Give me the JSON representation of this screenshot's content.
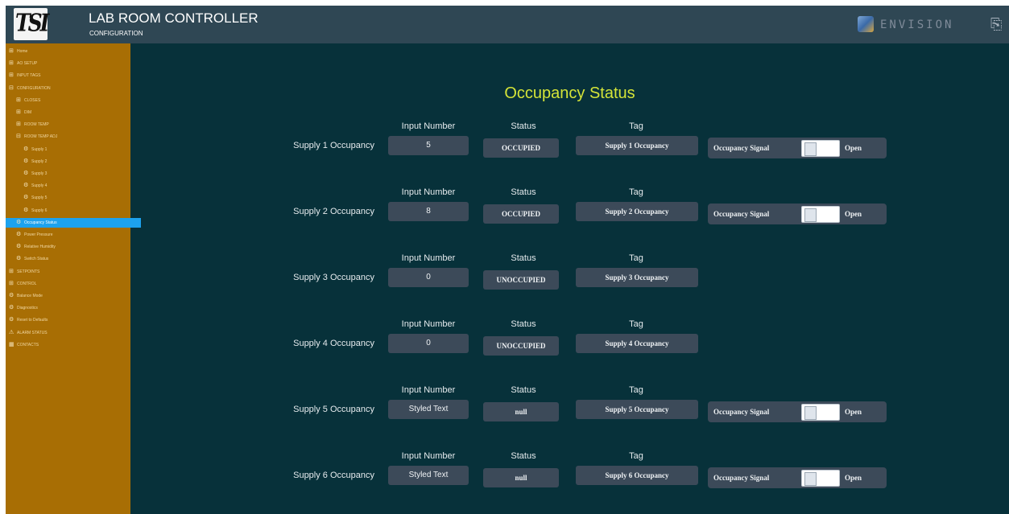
{
  "header": {
    "logo_text": "TSI",
    "title": "LAB ROOM CONTROLLER",
    "subtitle": "CONFIGURATION",
    "brand": "ENVISION",
    "brand_icon": "envision-logo-icon",
    "logout_icon": "logout-icon"
  },
  "sidebar": {
    "active_color": "#1da2ee",
    "background": "#a86e04",
    "items": [
      {
        "label": "Home",
        "icon": "plus-box",
        "level": 0
      },
      {
        "label": "AO SETUP",
        "icon": "plus-box",
        "level": 0
      },
      {
        "label": "INPUT TAGS",
        "icon": "plus-box",
        "level": 0
      },
      {
        "label": "CONFIGURATION",
        "icon": "minus-box",
        "level": 0
      },
      {
        "label": "CLOSES",
        "icon": "plus-box",
        "level": 1
      },
      {
        "label": "DIM",
        "icon": "plus-box",
        "level": 1
      },
      {
        "label": "ROOM TEMP",
        "icon": "plus-box",
        "level": 1
      },
      {
        "label": "ROOM TEMP ADJ",
        "icon": "minus-box",
        "level": 1
      },
      {
        "label": "Supply 1",
        "icon": "gear",
        "level": 2
      },
      {
        "label": "Supply 2",
        "icon": "gear",
        "level": 2
      },
      {
        "label": "Supply 3",
        "icon": "gear",
        "level": 2
      },
      {
        "label": "Supply 4",
        "icon": "gear",
        "level": 2
      },
      {
        "label": "Supply 5",
        "icon": "gear",
        "level": 2
      },
      {
        "label": "Supply 6",
        "icon": "gear",
        "level": 2
      },
      {
        "label": "Occupancy Status",
        "icon": "gear",
        "level": 1,
        "active": true
      },
      {
        "label": "Power Pressure",
        "icon": "gear",
        "level": 1
      },
      {
        "label": "Relative Humidity",
        "icon": "gear",
        "level": 1
      },
      {
        "label": "Switch Status",
        "icon": "gear",
        "level": 1
      },
      {
        "label": "SETPOINTS",
        "icon": "plus-box",
        "level": 0
      },
      {
        "label": "CONTROL",
        "icon": "plus-box",
        "level": 0
      },
      {
        "label": "Balance Mode",
        "icon": "gear",
        "level": 0
      },
      {
        "label": "Diagnostics",
        "icon": "gear",
        "level": 0
      },
      {
        "label": "Reset to Defaults",
        "icon": "gear",
        "level": 0
      },
      {
        "label": "ALARM STATUS",
        "icon": "warning",
        "level": 0
      },
      {
        "label": "CONTACTS",
        "icon": "grid",
        "level": 0
      }
    ]
  },
  "main": {
    "title": "Occupancy Status",
    "title_color": "#d4e438",
    "column_headers": {
      "input": "Input Number",
      "status": "Status",
      "tag": "Tag"
    },
    "rows": [
      {
        "label": "Supply 1 Occupancy",
        "input": "5",
        "status": "OCCUPIED",
        "tag": "Supply 1 Occupancy",
        "signal": {
          "label": "Occupancy Signal",
          "state": "Open"
        }
      },
      {
        "label": "Supply 2 Occupancy",
        "input": "8",
        "status": "OCCUPIED",
        "tag": "Supply 2 Occupancy",
        "signal": {
          "label": "Occupancy Signal",
          "state": "Open"
        }
      },
      {
        "label": "Supply 3 Occupancy",
        "input": "0",
        "status": "UNOCCUPIED",
        "tag": "Supply 3 Occupancy",
        "signal": null
      },
      {
        "label": "Supply 4 Occupancy",
        "input": "0",
        "status": "UNOCCUPIED",
        "tag": "Supply 4 Occupancy",
        "signal": null
      },
      {
        "label": "Supply 5 Occupancy",
        "input": "Styled Text",
        "status": "null",
        "tag": "Supply 5 Occupancy",
        "signal": {
          "label": "Occupancy Signal",
          "state": "Open"
        }
      },
      {
        "label": "Supply 6 Occupancy",
        "input": "Styled Text",
        "status": "null",
        "tag": "Supply 6 Occupancy",
        "signal": {
          "label": "Occupancy Signal",
          "state": "Open"
        }
      }
    ]
  }
}
